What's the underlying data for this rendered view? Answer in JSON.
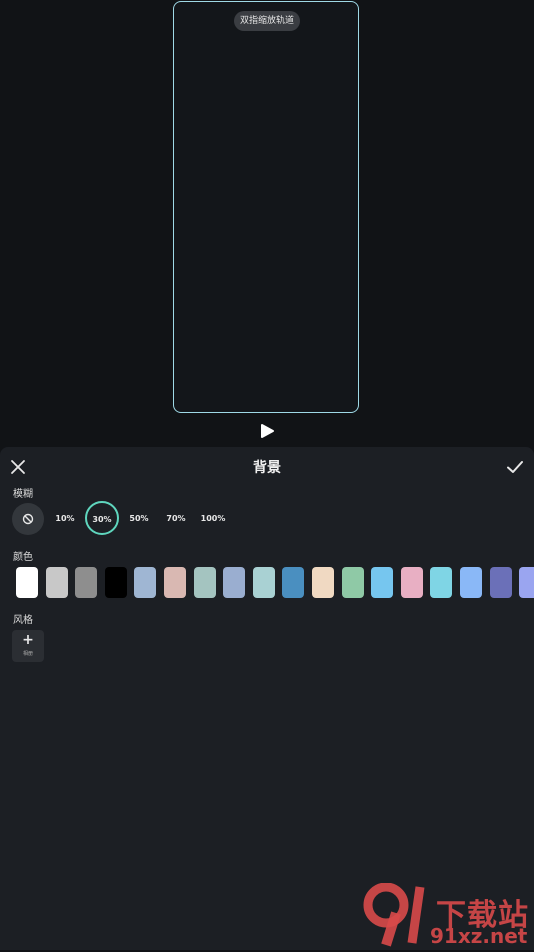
{
  "preview": {
    "hint": "双指缩放轨道",
    "frame_color": "#9fd9e6"
  },
  "panel": {
    "title": "背景",
    "blur": {
      "label": "模糊",
      "options": [
        "10%",
        "30%",
        "50%",
        "70%",
        "100%"
      ],
      "selected": "30%",
      "accent": "#5fd6be"
    },
    "color": {
      "label": "颜色",
      "swatches": [
        "#ffffff",
        "#c8c8c8",
        "#8e8e8e",
        "#000000",
        "#9fb6d3",
        "#d9b8b2",
        "#a4c4c0",
        "#9aaed0",
        "#a9d1d3",
        "#4a8fc0",
        "#f0d9c2",
        "#8fc9a6",
        "#76c6ef",
        "#e8afc3",
        "#7fd5e5",
        "#8ab8f7",
        "#6b70b8",
        "#9aa5f0"
      ]
    },
    "style": {
      "label": "风格",
      "add_label": "相册"
    }
  },
  "watermark": {
    "top": "下载站",
    "bottom": "91xz.net"
  }
}
